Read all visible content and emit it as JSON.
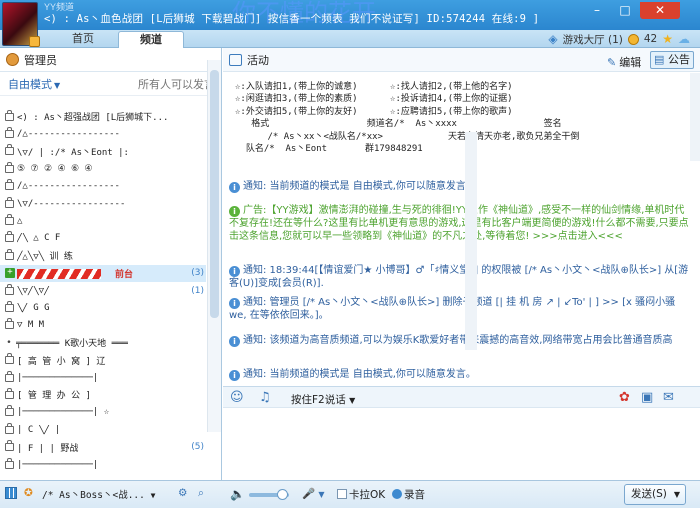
{
  "window": {
    "app_name": "YY频道",
    "title": "<) : As丶血色战团 [L后狮城 下载碧战门] 按信香一个频表 我们不说证写] ID:574244 在线:9 ]",
    "title_watermark": "你不懂的花开",
    "controls": {
      "minimize": "–",
      "maximize": "□",
      "close": "✕"
    }
  },
  "tabs": {
    "home": "首页",
    "channel": "频道"
  },
  "top_right": {
    "game_hall": "游戏大厅 (1)",
    "coins": "42"
  },
  "left_panel": {
    "header": "管理员",
    "mode": "自由模式",
    "mode_note": "所有人可以发言",
    "rows": [
      {
        "icon": "home",
        "name": "<) : As丶超强战团 [L后狮城下..."
      },
      {
        "icon": "lock",
        "name": "/△-----------------"
      },
      {
        "icon": "lock",
        "name": "\\▽/ | :/* As丶Eont  |:"
      },
      {
        "icon": "lock",
        "name": "  ⑤ ⑦ ② ④ ⑥ ④"
      },
      {
        "icon": "lock",
        "name": "/△-----------------"
      },
      {
        "icon": "lock",
        "name": "\\▽/-----------------"
      },
      {
        "icon": "lock",
        "name": "          △        ",
        "count": ""
      },
      {
        "icon": "lock",
        "name": "     ╱╲  △   C  F",
        "count": ""
      },
      {
        "icon": "lock",
        "name": "    ╱△╲▽╲  训 练",
        "count": ""
      },
      {
        "icon": "plus",
        "name": "前台",
        "count": "(3)",
        "selected": true
      },
      {
        "icon": "lock",
        "name": "    ╲▽╱╲▽╱       ",
        "count": "(1)"
      },
      {
        "icon": "lock",
        "name": "       ╲╱     G  G"
      },
      {
        "icon": "lock",
        "name": "        ▽     M  M"
      },
      {
        "icon": "dash",
        "name": "╤═══════ K歌小天地 ═══"
      },
      {
        "icon": "lock",
        "name": "[   高  管  小  窝   ]  辽"
      },
      {
        "icon": "lock",
        "name": "|─────────────|"
      },
      {
        "icon": "lock",
        "name": "[    管  理  办  公  ]"
      },
      {
        "icon": "lock",
        "name": "|─────────────|  ☆"
      },
      {
        "icon": "lock",
        "name": "|    C    ╲╱  |"
      },
      {
        "icon": "lock",
        "name": "|    F    |   |  野战",
        "count": "(5)"
      },
      {
        "icon": "lock",
        "name": "|─────────────|"
      }
    ]
  },
  "right_panel": {
    "header": "活动",
    "edit": "编辑",
    "notice": "公告",
    "notice_lines": [
      "☆:入队请扣1,(带上你的诚意)      ☆:找人请扣2,(带上他的名字)",
      "☆:闲逛请扣3,(带上你的素质)      ☆:投诉请扣4,(带上你的证据)",
      "☆:外交请扣5,(带上你的友好)      ☆:应聘请扣5,(带上你的歌声)",
      "   格式                  频道名/*  As丶xxxx                签名",
      "      /* As丶xx丶<战队名/*xx>            天若有情天亦老,歌负兄弟全干倒",
      "  队名/*  As丶Eont       群179848291"
    ],
    "messages": [
      {
        "kind": "sys",
        "text": "通知: 当前频道的模式是 自由模式,你可以随意发言。"
      },
      {
        "kind": "ad",
        "text": "广告:【YY游戏】激情澎湃的碰撞,生与死的徘徊!YY巨作《神仙道》,感受不一样的仙剑情缘,单机时代不复存在!还在等什么?这里有比单机更有意思的游戏,这里有比客户端更简便的游戏!什么都不需要,只要点击这条信息,您就可以早一些领略到《神仙道》的不凡之处,等待着您! >>>点击进入<<<"
      },
      {
        "kind": "sys",
        "text": "通知: 18:39:44[【情谊爱门★ 小博哥】♂「♯情义堂」] 的权限被 [/* As丶小文丶<战队⊕队长>] 从[游客(U)]变成[会员(R)]."
      },
      {
        "kind": "sys",
        "text": "通知: 管理员 [/* As丶小文丶<战队⊕队长>] 删除子频道 [|  挂  机  房  ↗  |  ↙To'     | ] >> [x     骚闷小骚we, 在等依依回来。]。"
      },
      {
        "kind": "sys",
        "text": "通知: 该频道为高音质频道,可以为娱乐K歌爱好者带来震撼的高音效,网络带宽占用会比普通音质高"
      },
      {
        "kind": "sys",
        "text": "通知: 当前频道的模式是 自由模式,你可以随意发言。"
      }
    ],
    "input_mode": "按住F2说话"
  },
  "bottom_bar": {
    "nick": "/* As丶Boss丶<战...",
    "karaoke": "卡拉OK",
    "record": "录音",
    "send": "发送(S)"
  },
  "colors": {
    "accent": "#2b86cf",
    "selected_text": "#d3362f",
    "notice_text": "#2e5f9e",
    "ad_text": "#4da32f"
  }
}
